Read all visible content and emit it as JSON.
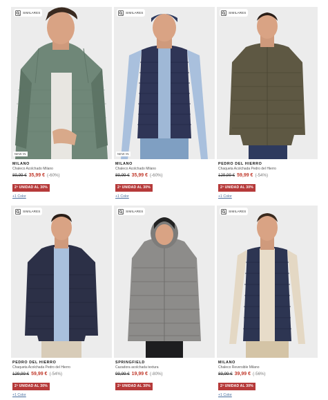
{
  "similar_label": "SIMILARES",
  "products": [
    {
      "brand": "MILANO",
      "name": "Chaleco Acolchado Milano",
      "old_price": "89,99 €",
      "new_price": "35,99 €",
      "discount": "(-60%)",
      "promo": "2ª UNIDAD AL 30%",
      "colors": "+1 Color",
      "tag": "NEW IN",
      "image_color": "#6f8778"
    },
    {
      "brand": "MILANO",
      "name": "Chaleco Acolchado Milano",
      "old_price": "89,99 €",
      "new_price": "35,99 €",
      "discount": "(-60%)",
      "promo": "2ª UNIDAD AL 30%",
      "colors": "+1 Color",
      "tag": "NEW IN",
      "image_color": "#2f3556"
    },
    {
      "brand": "PEDRO DEL HIERRO",
      "name": "Chaqueta Acolchada Pedro del Hierro",
      "old_price": "129,99 €",
      "new_price": "59,99 €",
      "discount": "(-54%)",
      "promo": "2ª UNIDAD AL 30%",
      "colors": "+1 Color",
      "tag": "",
      "image_color": "#5e5843"
    },
    {
      "brand": "PEDRO DEL HIERRO",
      "name": "Chaqueta Acolchada Pedro del Hierro",
      "old_price": "129,99 €",
      "new_price": "59,99 €",
      "discount": "(-54%)",
      "promo": "2ª UNIDAD AL 30%",
      "colors": "+1 Color",
      "tag": "",
      "image_color": "#2c3047"
    },
    {
      "brand": "SPRINGFIELD",
      "name": "Cazadora acolchada textura",
      "old_price": "99,99 €",
      "new_price": "19,99 €",
      "discount": "(-80%)",
      "promo": "2ª UNIDAD AL 30%",
      "colors": "",
      "tag": "",
      "image_color": "#8d8c8a"
    },
    {
      "brand": "MILANO",
      "name": "Chaleco Reversible Milano",
      "old_price": "89,99 €",
      "new_price": "39,99 €",
      "discount": "(-56%)",
      "promo": "2ª UNIDAD AL 30%",
      "colors": "+1 Color",
      "tag": "",
      "image_color": "#2d3552"
    }
  ]
}
